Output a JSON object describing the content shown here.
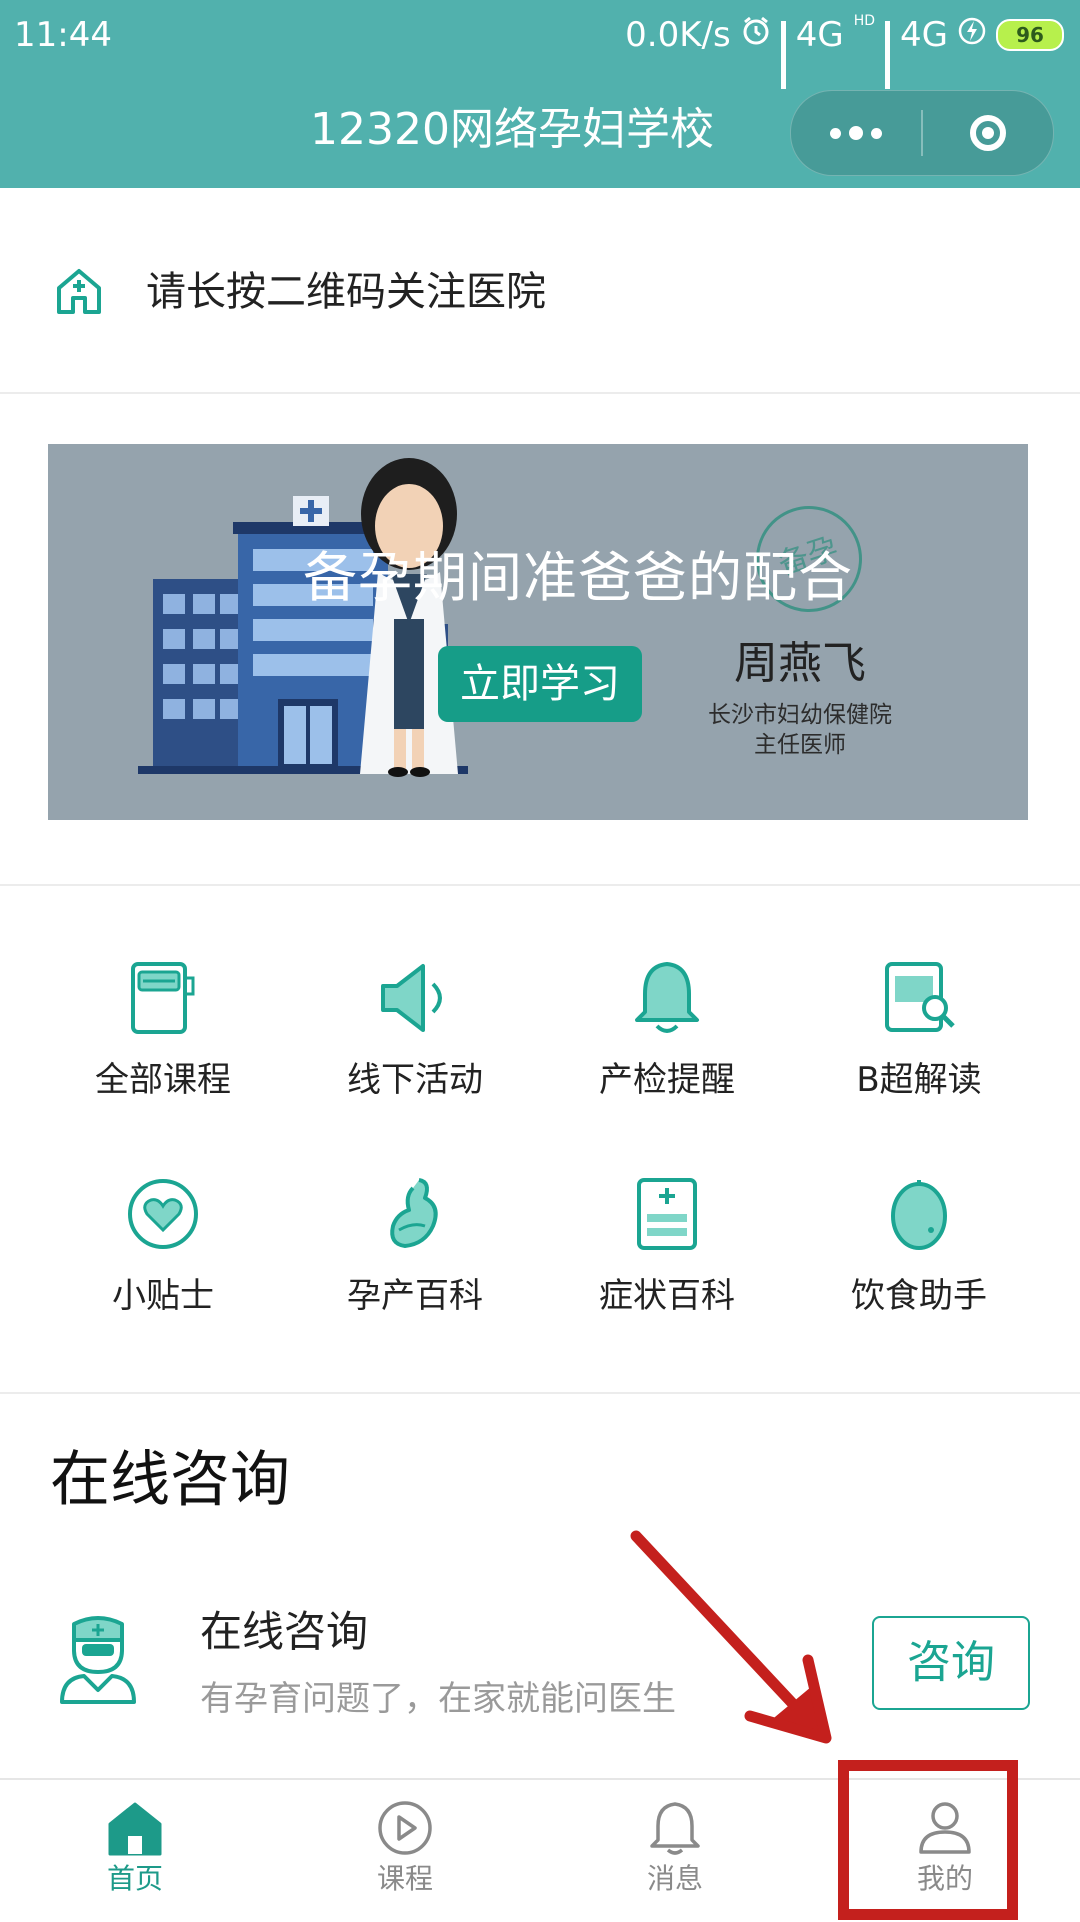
{
  "status_bar": {
    "time": "11:44",
    "net_speed": "0.0K/s",
    "network_1": "4G",
    "hd_badge": "HD",
    "network_2": "4G",
    "battery": "96"
  },
  "header": {
    "title": "12320网络孕妇学校",
    "more_icon": "more-dots-icon",
    "close_icon": "target-close-icon"
  },
  "follow_bar": {
    "icon": "hospital-icon",
    "text": "请长按二维码关注医院"
  },
  "banner": {
    "title": "备孕期间准爸爸的配合",
    "button_label": "立即学习",
    "stamp_text": "备孕",
    "doctor_name": "周燕飞",
    "doctor_hospital": "长沙市妇幼保健院",
    "doctor_title": "主任医师"
  },
  "features": [
    {
      "label": "全部课程",
      "icon": "course-book-icon"
    },
    {
      "label": "线下活动",
      "icon": "megaphone-icon"
    },
    {
      "label": "产检提醒",
      "icon": "bell-icon"
    },
    {
      "label": "B超解读",
      "icon": "ultrasound-search-icon"
    },
    {
      "label": "小贴士",
      "icon": "heart-circle-icon"
    },
    {
      "label": "孕产百科",
      "icon": "pregnant-icon"
    },
    {
      "label": "症状百科",
      "icon": "medical-record-icon"
    },
    {
      "label": "饮食助手",
      "icon": "lemon-icon"
    }
  ],
  "consult": {
    "section_title": "在线咨询",
    "item_title": "在线咨询",
    "item_subtitle": "有孕育问题了，在家就能问医生",
    "button_label": "咨询",
    "icon": "doctor-icon"
  },
  "tab_bar": {
    "tabs": [
      {
        "label": "首页",
        "icon": "home-icon",
        "active": true
      },
      {
        "label": "课程",
        "icon": "play-circle-icon",
        "active": false
      },
      {
        "label": "消息",
        "icon": "bell-outline-icon",
        "active": false
      },
      {
        "label": "我的",
        "icon": "user-icon",
        "active": false
      }
    ]
  },
  "colors": {
    "header": "#51b1ad",
    "accent": "#1ba592",
    "banner_bg": "#95a3ad",
    "annotation": "#c4201d"
  }
}
